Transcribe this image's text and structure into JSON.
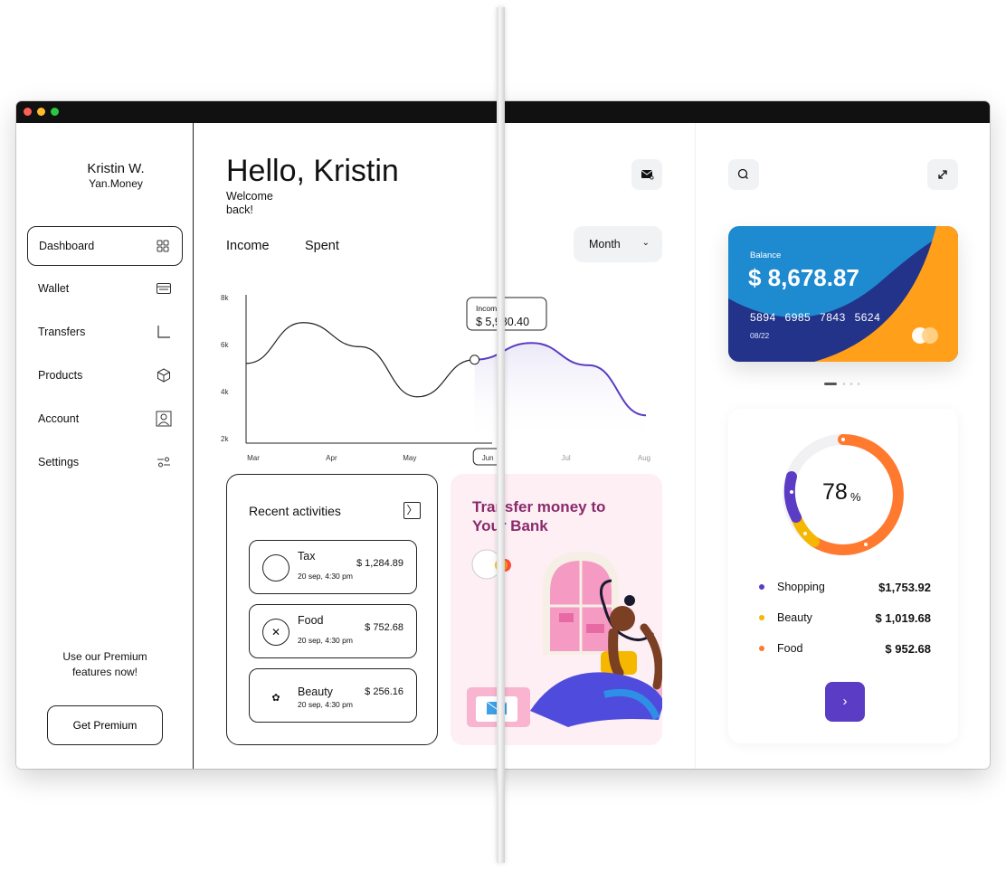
{
  "sidebar": {
    "user_name": "Kristin W.",
    "user_sub": "Yan.Money",
    "items": [
      {
        "label": "Dashboard",
        "icon": "grid-icon"
      },
      {
        "label": "Wallet",
        "icon": "wallet-icon"
      },
      {
        "label": "Transfers",
        "icon": "transfer-icon"
      },
      {
        "label": "Products",
        "icon": "box-icon"
      },
      {
        "label": "Account",
        "icon": "user-icon"
      },
      {
        "label": "Settings",
        "icon": "sliders-icon"
      }
    ],
    "premium_text_1": "Use our Premium",
    "premium_text_2": "features now!",
    "premium_button": "Get Premium"
  },
  "header": {
    "greeting": "Hello, Kristin",
    "welcome": "Welcome back!"
  },
  "tabs": {
    "income": "Income",
    "spent": "Spent"
  },
  "period": {
    "selected": "Month"
  },
  "chart_data": {
    "type": "line",
    "x": [
      "Mar",
      "Apr",
      "May",
      "Jun",
      "Jul",
      "Aug"
    ],
    "y_ticks": [
      "8k",
      "6k",
      "4k",
      "2k"
    ],
    "ylim": [
      1000,
      9000
    ],
    "series": [
      {
        "values": [
          5300,
          7500,
          6200,
          3500,
          5500,
          6400,
          5200,
          2500
        ]
      }
    ],
    "tooltip": {
      "label": "Income",
      "value": "$ 5,980.40"
    },
    "highlighted_x": "Jun"
  },
  "activities": {
    "title": "Recent activities",
    "items": [
      {
        "name": "Tax",
        "date": "20 sep, 4:30 pm",
        "amount": "$ 1,284.89"
      },
      {
        "name": "Food",
        "date": "20 sep, 4:30 pm",
        "amount": "$ 752.68"
      },
      {
        "name": "Beauty",
        "date": "20 sep, 4:30 pm",
        "amount": "$ 256.16"
      }
    ]
  },
  "transfer": {
    "title": "Transfer money to Your Bank"
  },
  "bank_card": {
    "balance_label": "Balance",
    "balance": "$ 8,678.87",
    "number": "5894 6985 7843 5624",
    "expiry": "08/22"
  },
  "stats": {
    "percent": "78",
    "percent_sign": "%",
    "categories": [
      {
        "name": "Shopping",
        "value": "$1,753.92",
        "color": "#5b3cc4"
      },
      {
        "name": "Beauty",
        "value": "$ 1,019.68",
        "color": "#f5b700"
      },
      {
        "name": "Food",
        "value": "$ 952.68",
        "color": "#ff7a2f"
      }
    ]
  },
  "colors": {
    "accent": "#5b3cc4",
    "card_blue": "#1e8bd0",
    "card_navy": "#23338a",
    "card_orange": "#ff9f1a",
    "donut_orange": "#ff7a2f",
    "donut_yellow": "#f5b700",
    "transfer_title": "#8b2a6b"
  }
}
